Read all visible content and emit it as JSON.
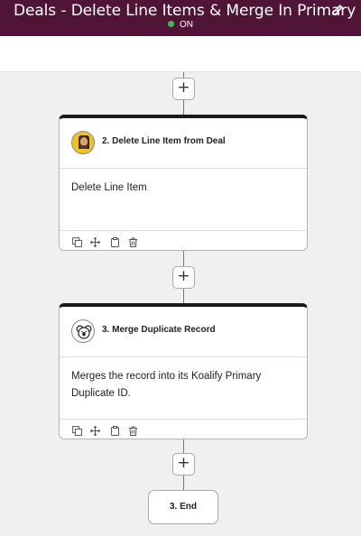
{
  "workflow": {
    "title": "Deals - Delete Line Items & Merge In Primary",
    "status": "ON",
    "status_color": "#3fb950",
    "header_color": "#4f1436"
  },
  "steps": [
    {
      "title": "2. Delete Line Item from Deal",
      "description": "Delete Line Item",
      "icon": "yellow-avatar-icon",
      "tools": [
        "copy-icon",
        "move-icon",
        "clipboard-icon",
        "trash-icon"
      ]
    },
    {
      "title": "3. Merge Duplicate Record",
      "description": "Merges the record into its Koalify Primary Duplicate ID.",
      "icon": "koala-icon",
      "tools": [
        "copy-icon",
        "move-icon",
        "clipboard-icon",
        "trash-icon"
      ]
    }
  ],
  "add_button_label": "+",
  "end_node": {
    "label": "3. End"
  }
}
